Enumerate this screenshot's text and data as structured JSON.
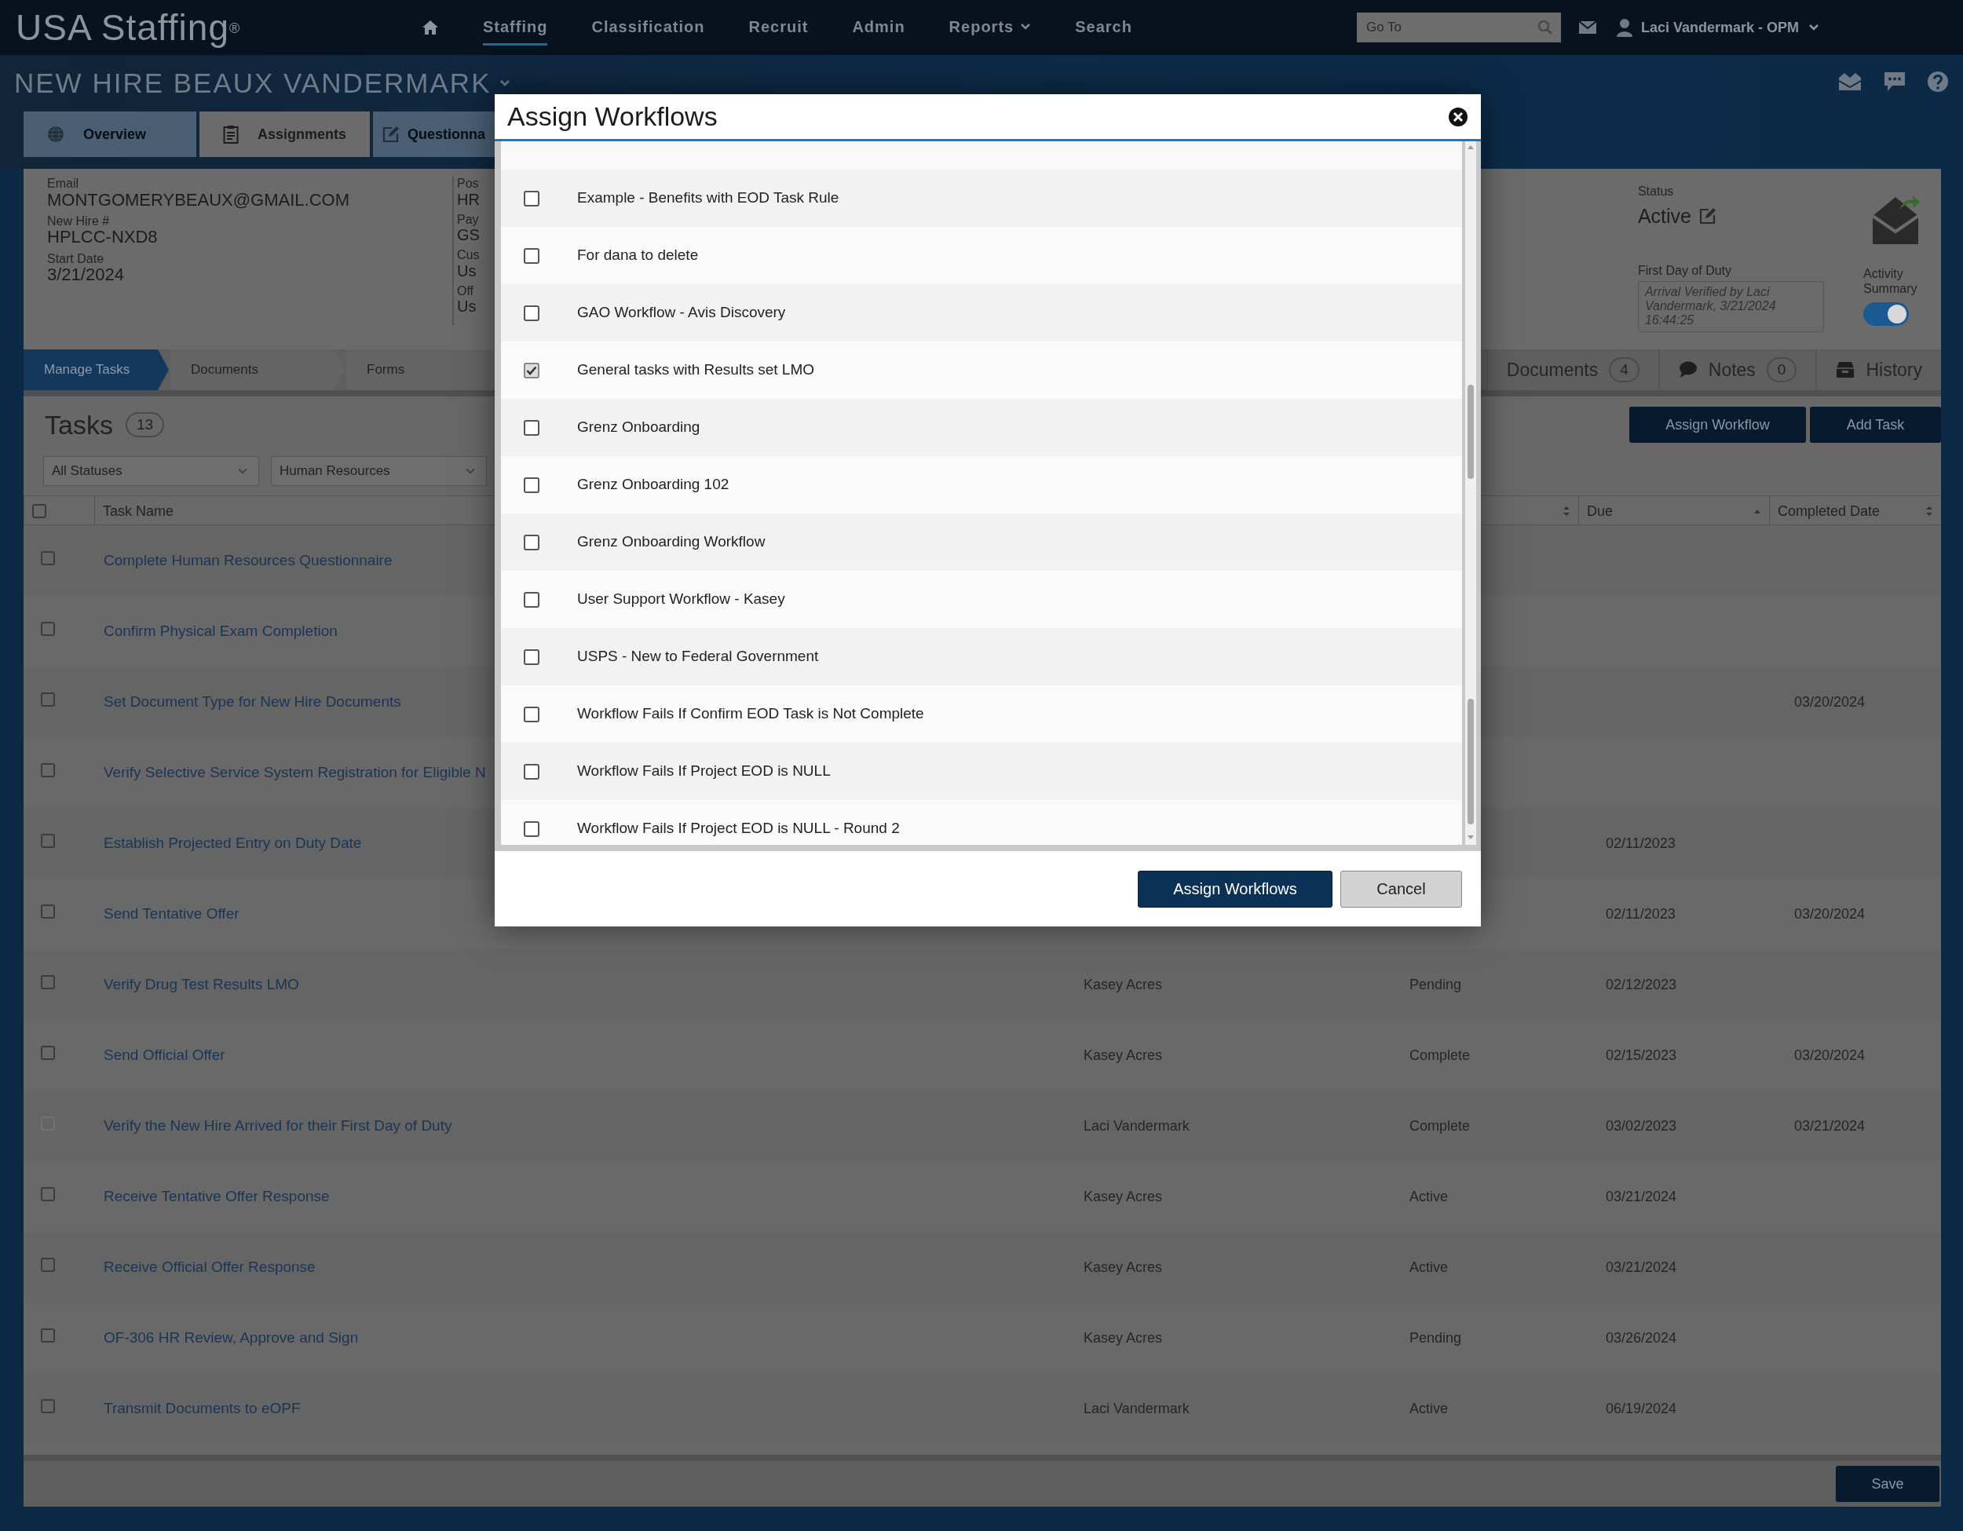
{
  "app": {
    "logo": "USA Staffing$^{®}$"
  },
  "nav": [
    {
      "label": "Staffing",
      "selected": true,
      "dropdown": false
    },
    {
      "label": "Classification",
      "selected": false,
      "dropdown": false
    },
    {
      "label": "Recruit",
      "selected": false,
      "dropdown": false
    },
    {
      "label": "Admin",
      "selected": false,
      "dropdown": false
    },
    {
      "label": "Reports",
      "selected": false,
      "dropdown": true
    },
    {
      "label": "Search",
      "selected": false,
      "dropdown": false
    }
  ],
  "goto": {
    "placeholder": "Go To"
  },
  "user": {
    "name": "Laci Vandermark - OPM"
  },
  "page_title": "NEW HIRE BEAUX VANDERMARK",
  "tabs": [
    {
      "label": "Overview",
      "selected": false,
      "kind": "globe"
    },
    {
      "label": "Assignments",
      "selected": true,
      "kind": "clipboard"
    },
    {
      "label": "Questionna",
      "selected": false,
      "kind": "edit"
    }
  ],
  "details": {
    "column_1": [
      {
        "label": "Email",
        "value": "MONTGOMERYBEAUX@GMAIL.COM"
      },
      {
        "label": "New Hire #",
        "value": "HPLCC-NXD8"
      },
      {
        "label": "Start Date",
        "value": "3/21/2024"
      }
    ],
    "column_2": [
      {
        "label": "Pos",
        "value": "HR"
      },
      {
        "label": "Pay",
        "value": "GS"
      },
      {
        "label": "Cus",
        "value": "Us"
      },
      {
        "label": "Off",
        "value": "Us"
      }
    ]
  },
  "status": {
    "label": "Status",
    "value": "Active"
  },
  "first_day": {
    "label": "First Day of Duty",
    "value": "Arrival Verified by Laci Vandermark, 3/21/2024 16:44:25"
  },
  "activity_summary": {
    "label": "Activity Summary",
    "on": true
  },
  "steps": [
    {
      "label": "Manage Tasks",
      "selected": true
    },
    {
      "label": "Documents",
      "selected": false
    },
    {
      "label": "Forms",
      "selected": false
    }
  ],
  "side_tabs": [
    {
      "label": "Documents",
      "count": "4",
      "kind": "count"
    },
    {
      "label": "Notes",
      "count": "0",
      "kind": "notes"
    },
    {
      "label": "History",
      "kind": "history"
    }
  ],
  "tasks": {
    "title": "Tasks",
    "count": "13",
    "filters": [
      "All Statuses",
      "Human Resources"
    ],
    "buttons": [
      "Assign Workflow",
      "Add Task"
    ],
    "select_all": {
      "checked": false
    },
    "columns": {
      "name": "Task Name",
      "due": "Due",
      "completed": "Completed Date"
    },
    "rows": [
      {
        "name": "Complete Human Resources Questionnaire",
        "disabled": false
      },
      {
        "name": "Confirm Physical Exam Completion",
        "disabled": false
      },
      {
        "name": "Set Document Type for New Hire Documents",
        "completed": "03/20/2024",
        "disabled": false
      },
      {
        "name": "Verify Selective Service System Registration for Eligible N",
        "disabled": false
      },
      {
        "name": "Establish Projected Entry on Duty Date",
        "due": "02/11/2023",
        "disabled": false
      },
      {
        "name": "Send Tentative Offer",
        "due": "02/11/2023",
        "completed": "03/20/2024",
        "disabled": false
      },
      {
        "name": "Verify Drug Test Results LMO",
        "assignee": "Kasey Acres",
        "status": "Pending",
        "due": "02/12/2023",
        "disabled": false
      },
      {
        "name": "Send Official Offer",
        "assignee": "Kasey Acres",
        "status": "Complete",
        "due": "02/15/2023",
        "completed": "03/20/2024",
        "disabled": false
      },
      {
        "name": "Verify the New Hire Arrived for their First Day of Duty",
        "assignee": "Laci Vandermark",
        "status": "Complete",
        "due": "03/02/2023",
        "completed": "03/21/2024",
        "disabled": true
      },
      {
        "name": "Receive Tentative Offer Response",
        "assignee": "Kasey Acres",
        "status": "Active",
        "due": "03/21/2024",
        "disabled": false
      },
      {
        "name": "Receive Official Offer Response",
        "assignee": "Kasey Acres",
        "status": "Active",
        "due": "03/21/2024",
        "disabled": false
      },
      {
        "name": "OF-306 HR Review, Approve and Sign",
        "assignee": "Kasey Acres",
        "status": "Pending",
        "due": "03/26/2024",
        "disabled": false
      },
      {
        "name": "Transmit Documents to eOPF",
        "assignee": "Laci Vandermark",
        "status": "Active",
        "due": "06/19/2024",
        "disabled": false
      }
    ]
  },
  "save": "Save",
  "modal": {
    "title": "Assign Workflows",
    "items": [
      {
        "label": "Example - Benefits with EOD Task Rule",
        "checked": false
      },
      {
        "label": "For dana to delete",
        "checked": false
      },
      {
        "label": "GAO Workflow - Avis Discovery",
        "checked": false
      },
      {
        "label": "General tasks with Results set LMO",
        "checked": true
      },
      {
        "label": "Grenz Onboarding",
        "checked": false
      },
      {
        "label": "Grenz Onboarding 102",
        "checked": false
      },
      {
        "label": "Grenz Onboarding Workflow",
        "checked": false
      },
      {
        "label": "User Support Workflow - Kasey",
        "checked": false
      },
      {
        "label": "USPS - New to Federal Government",
        "checked": false
      },
      {
        "label": "Workflow Fails If Confirm EOD Task is Not Complete",
        "checked": false
      },
      {
        "label": "Workflow Fails If Project EOD is NULL",
        "checked": false
      },
      {
        "label": "Workflow Fails If Project EOD is NULL - Round 2",
        "checked": false
      }
    ],
    "primary": "Assign Workflows",
    "cancel": "Cancel"
  }
}
